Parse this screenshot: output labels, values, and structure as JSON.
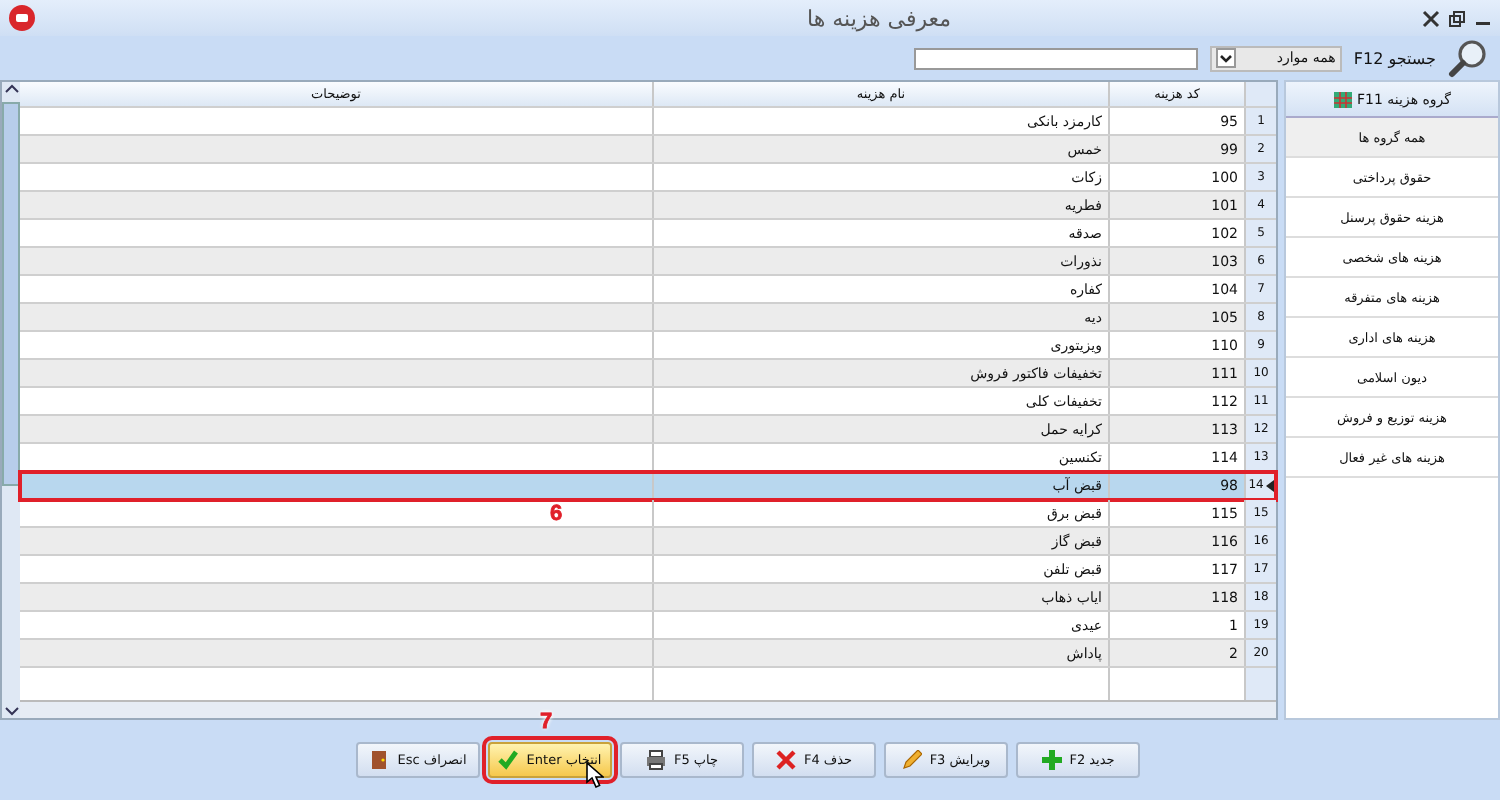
{
  "window": {
    "title": "معرفی هزینه ها"
  },
  "search": {
    "label": "جستجو F12",
    "scope": "همه موارد"
  },
  "table": {
    "columns": [
      "کد هزینه",
      "نام هزینه",
      "توضیحات"
    ],
    "rows": [
      {
        "number": "1",
        "code": "95",
        "name": "کارمزد بانکی",
        "selected": false
      },
      {
        "number": "2",
        "code": "99",
        "name": "خمس",
        "selected": false
      },
      {
        "number": "3",
        "code": "100",
        "name": "زکات",
        "selected": false
      },
      {
        "number": "4",
        "code": "101",
        "name": "فطریه",
        "selected": false
      },
      {
        "number": "5",
        "code": "102",
        "name": "صدقه",
        "selected": false
      },
      {
        "number": "6",
        "code": "103",
        "name": "نذورات",
        "selected": false
      },
      {
        "number": "7",
        "code": "104",
        "name": "کفاره",
        "selected": false
      },
      {
        "number": "8",
        "code": "105",
        "name": "دیه",
        "selected": false
      },
      {
        "number": "9",
        "code": "110",
        "name": "ویزیتوری",
        "selected": false
      },
      {
        "number": "10",
        "code": "111",
        "name": "تخفیفات فاکتور فروش",
        "selected": false
      },
      {
        "number": "11",
        "code": "112",
        "name": "تخفیفات کلی",
        "selected": false
      },
      {
        "number": "12",
        "code": "113",
        "name": "کرایه حمل",
        "selected": false
      },
      {
        "number": "13",
        "code": "114",
        "name": "تکنسین",
        "selected": false
      },
      {
        "number": "14",
        "code": "98",
        "name": "قبض آب",
        "selected": true,
        "callout": "6"
      },
      {
        "number": "15",
        "code": "115",
        "name": "قبض برق",
        "selected": false
      },
      {
        "number": "16",
        "code": "116",
        "name": "قبض گاز",
        "selected": false
      },
      {
        "number": "17",
        "code": "117",
        "name": "قبض تلفن",
        "selected": false
      },
      {
        "number": "18",
        "code": "118",
        "name": "ایاب ذهاب",
        "selected": false
      },
      {
        "number": "19",
        "code": "1",
        "name": "عیدی",
        "selected": false
      },
      {
        "number": "20",
        "code": "2",
        "name": "پاداش",
        "selected": false
      }
    ]
  },
  "groups": {
    "title": "گروه هزینه F11",
    "items": [
      {
        "label": "همه گروه ها",
        "selected": true
      },
      {
        "label": "حقوق پرداختی",
        "selected": false
      },
      {
        "label": "هزینه حقوق پرسنل",
        "selected": false
      },
      {
        "label": "هزینه های شخصی",
        "selected": false
      },
      {
        "label": "هزینه های متفرقه",
        "selected": false
      },
      {
        "label": "هزینه های اداری",
        "selected": false
      },
      {
        "label": "دیون اسلامی",
        "selected": false
      },
      {
        "label": "هزینه توزیع و فروش",
        "selected": false
      },
      {
        "label": "هزینه های غیر فعال",
        "selected": false
      }
    ]
  },
  "buttons": [
    {
      "label": "جدید F2",
      "kind": "add",
      "highlighted": false
    },
    {
      "label": "ویرایش F3",
      "kind": "edit",
      "highlighted": false
    },
    {
      "label": "حذف F4",
      "kind": "delete",
      "highlighted": false
    },
    {
      "label": "چاپ F5",
      "kind": "print",
      "highlighted": false
    },
    {
      "label": "انتخاب Enter",
      "kind": "select",
      "highlighted": true,
      "callout": "7"
    },
    {
      "label": "انصراف Esc",
      "kind": "cancel",
      "highlighted": false
    }
  ]
}
